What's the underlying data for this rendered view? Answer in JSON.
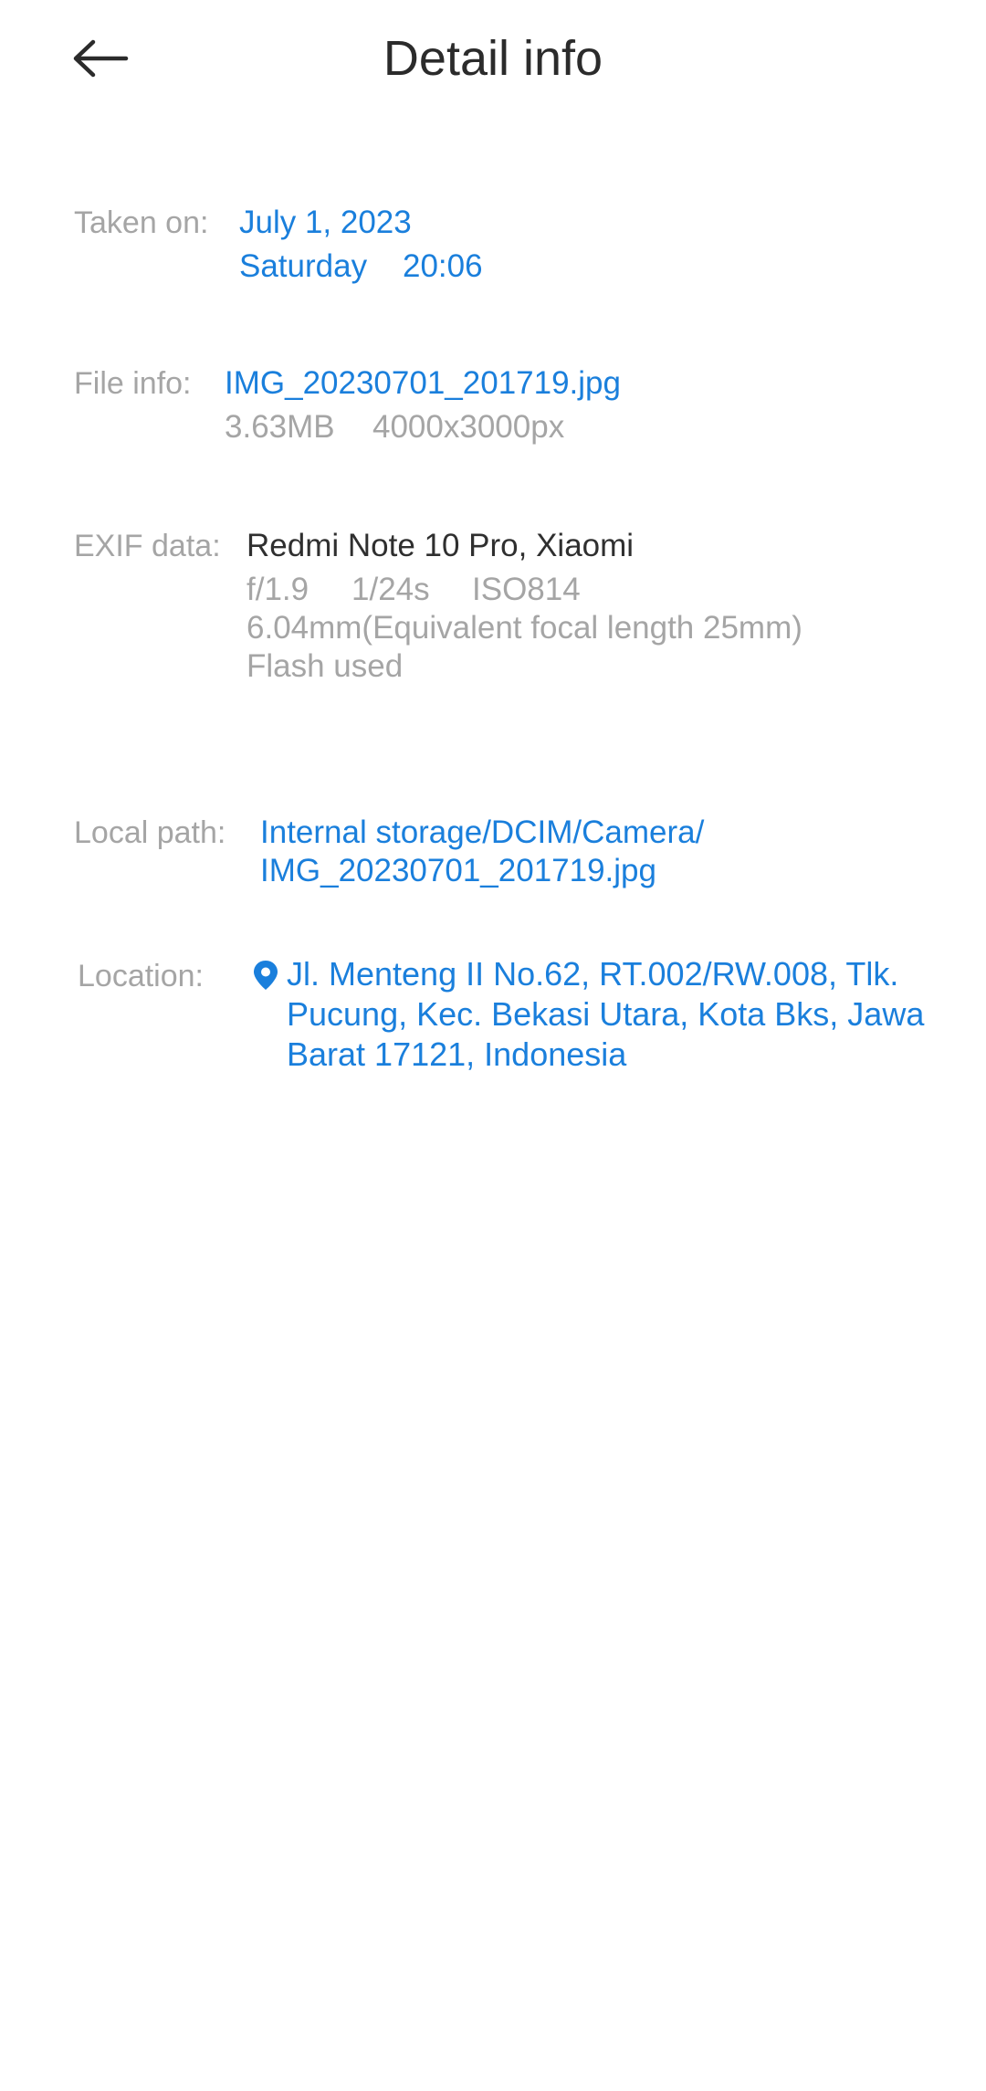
{
  "header": {
    "title": "Detail info"
  },
  "taken_on": {
    "label": "Taken on:",
    "date": "July 1, 2023",
    "weekday": "Saturday",
    "time": "20:06"
  },
  "file_info": {
    "label": "File info:",
    "filename": "IMG_20230701_201719.jpg",
    "size": "3.63MB",
    "resolution": "4000x3000px"
  },
  "exif": {
    "label": "EXIF data:",
    "device": "Redmi Note 10 Pro, Xiaomi",
    "aperture": "f/1.9",
    "shutter": "1/24s",
    "iso": "ISO814",
    "focal": "6.04mm(Equivalent focal length 25mm)",
    "flash": "Flash used"
  },
  "local_path": {
    "label": "Local path:",
    "line1": "Internal storage/DCIM/Camera/",
    "line2": "IMG_20230701_201719.jpg"
  },
  "location": {
    "label": "Location:",
    "address": "Jl. Menteng II No.62, RT.002/RW.008, Tlk. Pucung, Kec. Bekasi Utara, Kota Bks, Jawa Barat 17121, Indonesia",
    "icon": "location-pin-icon"
  },
  "colors": {
    "accent": "#1a7fdc",
    "label": "#a5a5a5",
    "text": "#2f2f2f"
  }
}
